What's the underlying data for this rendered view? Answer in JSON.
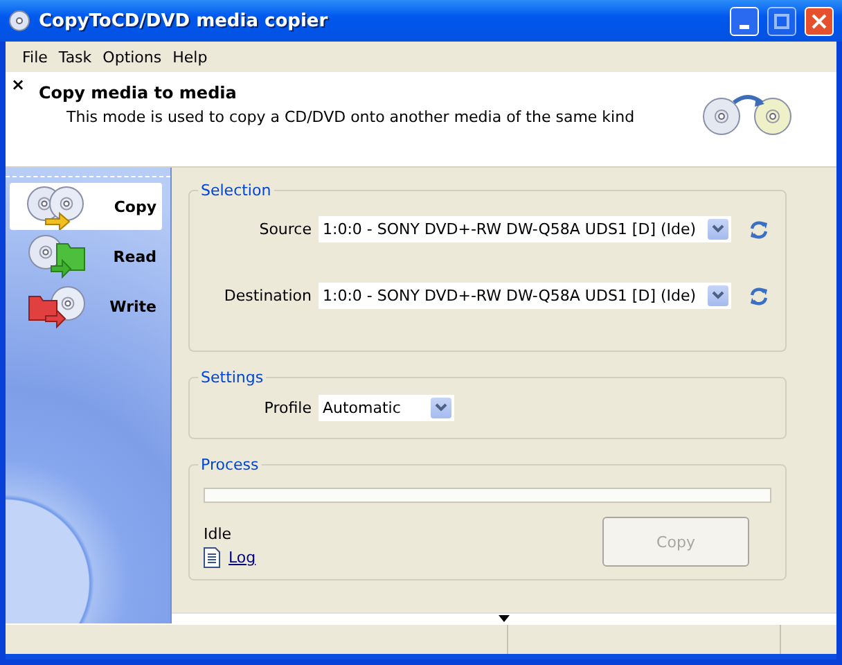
{
  "window": {
    "title": "CopyToCD/DVD media copier"
  },
  "menu": [
    "File",
    "Task",
    "Options",
    "Help"
  ],
  "header": {
    "close": "×",
    "title": "Copy media to media",
    "description": "This mode is used to copy a CD/DVD onto another media of the same kind"
  },
  "sidebar": {
    "items": [
      {
        "label": "Copy",
        "kind": "copy",
        "selected": true
      },
      {
        "label": "Read",
        "kind": "read",
        "selected": false
      },
      {
        "label": "Write",
        "kind": "write",
        "selected": false
      }
    ]
  },
  "selection": {
    "title": "Selection",
    "rows": [
      {
        "label": "Source",
        "value": "1:0:0 - SONY DVD+-RW DW-Q58A UDS1 [D] (Ide)"
      },
      {
        "label": "Destination",
        "value": "1:0:0 - SONY DVD+-RW DW-Q58A UDS1 [D] (Ide)"
      }
    ]
  },
  "settings": {
    "title": "Settings",
    "label": "Profile",
    "value": "Automatic"
  },
  "process": {
    "title": "Process",
    "level": 0,
    "status": "Idle",
    "log": "Log",
    "button": {
      "label": "Copy",
      "disabled": true
    }
  }
}
